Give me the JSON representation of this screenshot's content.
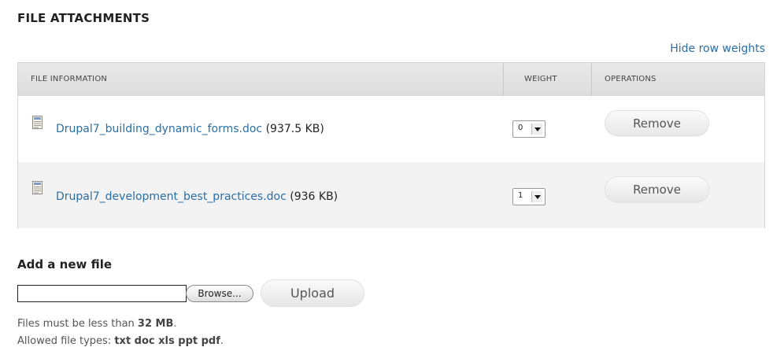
{
  "section": {
    "title": "FILE ATTACHMENTS",
    "hide_weights_link": "Hide row weights"
  },
  "table": {
    "headers": {
      "file_information": "FILE INFORMATION",
      "weight": "WEIGHT",
      "operations": "OPERATIONS"
    },
    "rows": [
      {
        "icon": "document-icon",
        "filename": "Drupal7_building_dynamic_forms.doc",
        "size": "(937.5 KB)",
        "weight": "0",
        "remove_label": "Remove"
      },
      {
        "icon": "document-icon",
        "filename": "Drupal7_development_best_practices.doc",
        "size": "(936 KB)",
        "weight": "1",
        "remove_label": "Remove"
      }
    ]
  },
  "upload": {
    "label": "Add a new file",
    "file_value": "",
    "browse_label": "Browse...",
    "upload_label": "Upload",
    "size_limit_prefix": "Files must be less than ",
    "size_limit_value": "32 MB",
    "size_limit_suffix": ".",
    "types_prefix": "Allowed file types: ",
    "types_value": "txt doc xls ppt pdf",
    "types_suffix": "."
  },
  "colors": {
    "link": "#2a6ea6",
    "header_bg": "#e3e3e3",
    "row_alt_bg": "#f3f3f3"
  }
}
